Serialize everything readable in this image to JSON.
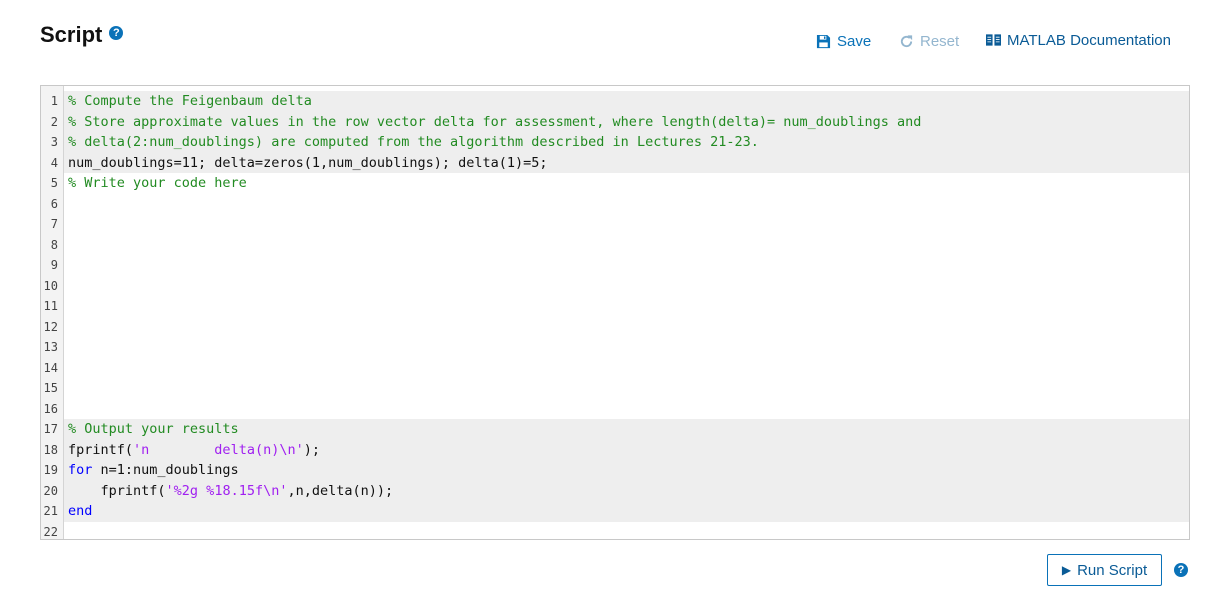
{
  "header": {
    "title": "Script",
    "help_icon": "?"
  },
  "toolbar": {
    "save_label": "Save",
    "reset_label": "Reset",
    "docs_label": "MATLAB Documentation"
  },
  "editor": {
    "lines": [
      {
        "n": "1",
        "ro": true,
        "tokens": [
          {
            "t": "% Compute the Feigenbaum delta",
            "c": "cmt"
          }
        ]
      },
      {
        "n": "2",
        "ro": true,
        "tokens": [
          {
            "t": "% Store approximate values in the row vector delta for assessment, where length(delta)= num_doublings and",
            "c": "cmt"
          }
        ]
      },
      {
        "n": "3",
        "ro": true,
        "tokens": [
          {
            "t": "% delta(2:num_doublings) are computed from the algorithm described in Lectures 21-23.",
            "c": "cmt"
          }
        ]
      },
      {
        "n": "4",
        "ro": true,
        "tokens": [
          {
            "t": "num_doublings=11; delta=zeros(1,num_doublings); delta(1)=5;",
            "c": ""
          }
        ]
      },
      {
        "n": "5",
        "ro": false,
        "tokens": [
          {
            "t": "% Write your code here",
            "c": "cmt"
          }
        ]
      },
      {
        "n": "6",
        "ro": false,
        "tokens": []
      },
      {
        "n": "7",
        "ro": false,
        "tokens": []
      },
      {
        "n": "8",
        "ro": false,
        "tokens": []
      },
      {
        "n": "9",
        "ro": false,
        "tokens": []
      },
      {
        "n": "10",
        "ro": false,
        "tokens": []
      },
      {
        "n": "11",
        "ro": false,
        "tokens": []
      },
      {
        "n": "12",
        "ro": false,
        "tokens": []
      },
      {
        "n": "13",
        "ro": false,
        "tokens": []
      },
      {
        "n": "14",
        "ro": false,
        "tokens": []
      },
      {
        "n": "15",
        "ro": false,
        "tokens": []
      },
      {
        "n": "16",
        "ro": false,
        "tokens": []
      },
      {
        "n": "17",
        "ro": true,
        "tokens": [
          {
            "t": "% Output your results",
            "c": "cmt"
          }
        ]
      },
      {
        "n": "18",
        "ro": true,
        "tokens": [
          {
            "t": "fprintf(",
            "c": ""
          },
          {
            "t": "'n        delta(n)\\n'",
            "c": "str"
          },
          {
            "t": ");",
            "c": ""
          }
        ]
      },
      {
        "n": "19",
        "ro": true,
        "tokens": [
          {
            "t": "for",
            "c": "kw"
          },
          {
            "t": " n=1:num_doublings",
            "c": ""
          }
        ]
      },
      {
        "n": "20",
        "ro": true,
        "tokens": [
          {
            "t": "    fprintf(",
            "c": ""
          },
          {
            "t": "'%2g %18.15f\\n'",
            "c": "str"
          },
          {
            "t": ",n,delta(n));",
            "c": ""
          }
        ]
      },
      {
        "n": "21",
        "ro": true,
        "tokens": [
          {
            "t": "end",
            "c": "kw"
          }
        ]
      },
      {
        "n": "22",
        "ro": false,
        "tokens": []
      }
    ]
  },
  "footer": {
    "run_label": "Run Script",
    "help_icon": "?"
  },
  "colors": {
    "accent": "#0a72b8",
    "comment": "#228b22",
    "string": "#a020f0",
    "keyword": "#0000ff",
    "readonly_bg": "#eeeeee"
  },
  "icons": {
    "save": "floppy-disk-icon",
    "reset": "refresh-icon",
    "docs": "book-icon",
    "run": "play-icon",
    "help": "question-circle-icon"
  }
}
